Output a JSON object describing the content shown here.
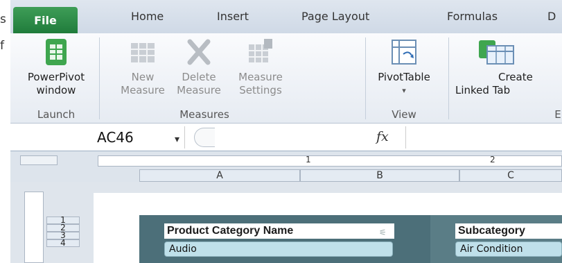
{
  "background_text": {
    "line1": "s",
    "line2": "f"
  },
  "tabs": [
    {
      "label": "File"
    },
    {
      "label": "Home"
    },
    {
      "label": "Insert"
    },
    {
      "label": "Page Layout"
    },
    {
      "label": "Formulas"
    },
    {
      "label": "D"
    }
  ],
  "ribbon": {
    "powerpivot": {
      "line1": "PowerPivot",
      "line2": "window"
    },
    "new_measure": {
      "line1": "New",
      "line2": "Measure"
    },
    "delete_measure": {
      "line1": "Delete",
      "line2": "Measure"
    },
    "measure_settings": {
      "line1": "Measure",
      "line2": "Settings"
    },
    "pivottable": {
      "line1": "PivotTable",
      "line2": "▾"
    },
    "create_linked": {
      "line1": "Create",
      "line2": "Linked Tab"
    },
    "groups": {
      "launch": "Launch",
      "measures": "Measures",
      "view": "View",
      "next": "E"
    }
  },
  "formula_bar": {
    "name_box": "AC46",
    "dropdown": "▾",
    "fx": "fx"
  },
  "ruler": {
    "marks": [
      "1",
      "2"
    ]
  },
  "columns": [
    "A",
    "B",
    "C"
  ],
  "rows": [
    "1",
    "2",
    "3",
    "4"
  ],
  "slicers": [
    {
      "title": "Product Category Name",
      "items": [
        "Audio"
      ]
    },
    {
      "title": "Subcategory",
      "items": [
        "Air Condition"
      ]
    }
  ],
  "colors": {
    "file_tab": "#2a8a44",
    "slicer_frame": "#4c6f79",
    "slicer_item": "#bfe0ea"
  }
}
